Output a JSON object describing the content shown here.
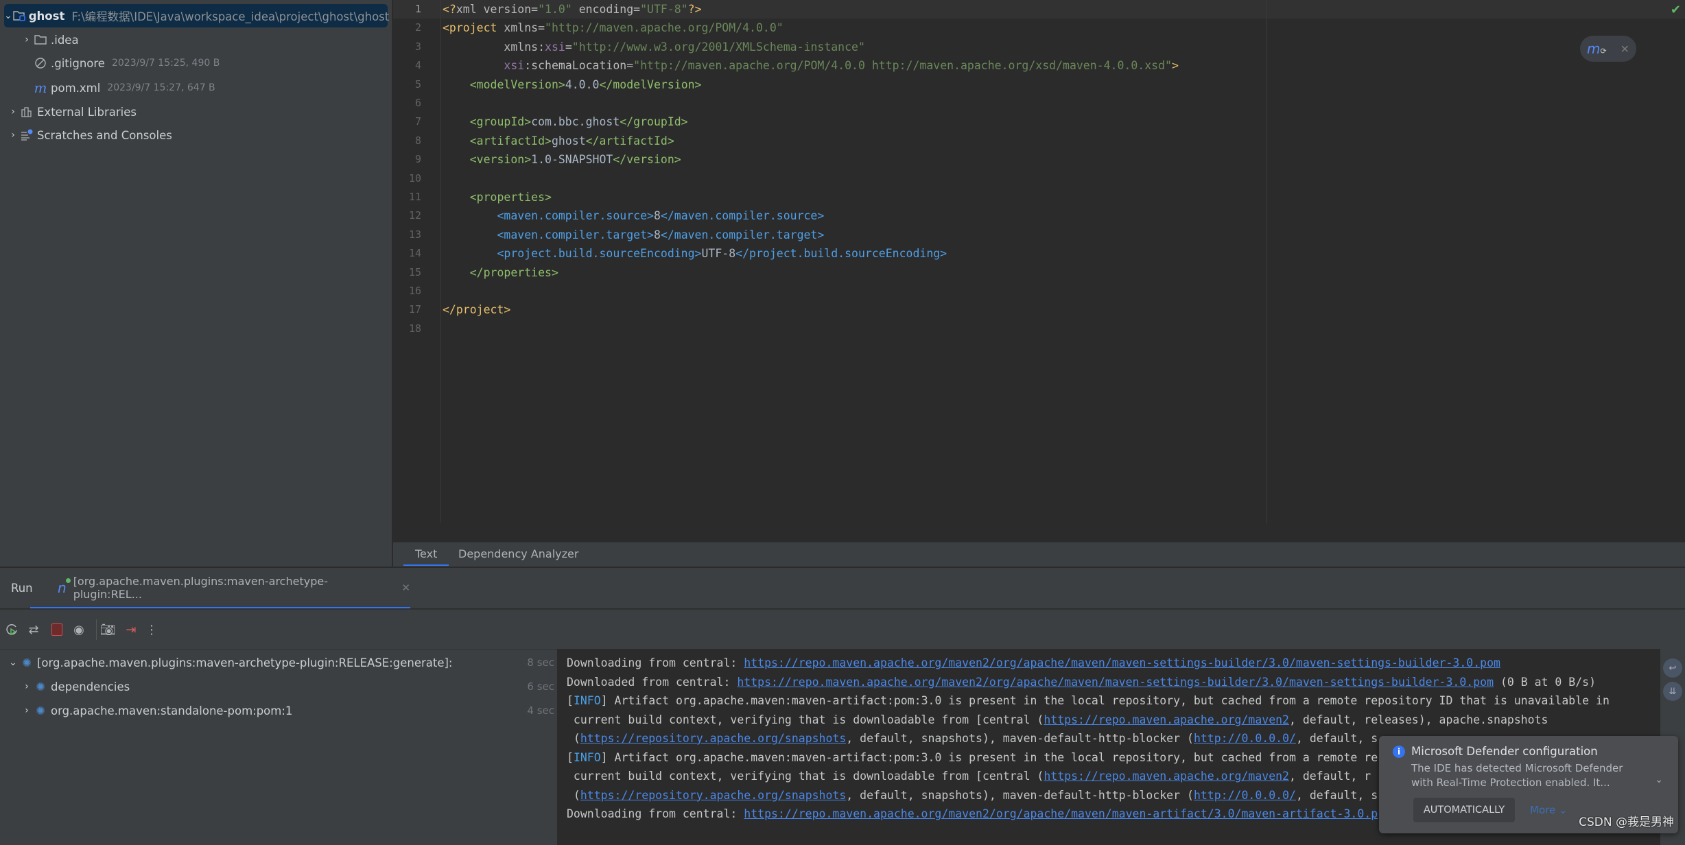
{
  "project_tree": {
    "root": {
      "name": "ghost",
      "path": "F:\\编程数据\\IDE\\Java\\workspace_idea\\project\\ghost\\ghost"
    },
    "items": [
      {
        "name": ".idea",
        "icon": "folder-icon",
        "meta": ""
      },
      {
        "name": ".gitignore",
        "icon": "ignore-icon",
        "meta": "2023/9/7 15:25, 490 B"
      },
      {
        "name": "pom.xml",
        "icon": "maven-icon",
        "meta": "2023/9/7 15:27, 647 B"
      }
    ],
    "external_libraries": "External Libraries",
    "scratches": "Scratches and Consoles"
  },
  "editor": {
    "lines": [
      [
        [
          "t-pi",
          "<?"
        ],
        [
          "t-attr",
          "xml version"
        ],
        [
          "t-attr",
          "="
        ],
        [
          "t-val",
          "\"1.0\""
        ],
        [
          "t-attr",
          " encoding"
        ],
        [
          "t-attr",
          "="
        ],
        [
          "t-val",
          "\"UTF-8\""
        ],
        [
          "t-pi",
          "?>"
        ]
      ],
      [
        [
          "t-tag",
          "<project"
        ],
        [
          "t-attr",
          " xmlns"
        ],
        [
          "t-attr",
          "="
        ],
        [
          "t-val",
          "\"http://maven.apache.org/POM/4.0.0\""
        ]
      ],
      [
        [
          "t-attr",
          "         xmlns:"
        ],
        [
          "t-ns",
          "xsi"
        ],
        [
          "t-attr",
          "="
        ],
        [
          "t-val",
          "\"http://www.w3.org/2001/XMLSchema-instance\""
        ]
      ],
      [
        [
          "t-attr",
          "         "
        ],
        [
          "t-ns",
          "xsi"
        ],
        [
          "t-attr",
          ":schemaLocation="
        ],
        [
          "t-val",
          "\"http://maven.apache.org/POM/4.0.0 http://maven.apache.org/xsd/maven-4.0.0.xsd\""
        ],
        [
          "t-tag",
          ">"
        ]
      ],
      [
        [
          "t-g",
          "    <modelVersion>"
        ],
        [
          "t-txt",
          "4.0.0"
        ],
        [
          "t-g",
          "</modelVersion>"
        ]
      ],
      [],
      [
        [
          "t-g",
          "    <groupId>"
        ],
        [
          "t-txt",
          "com.bbc.ghost"
        ],
        [
          "t-g",
          "</groupId>"
        ]
      ],
      [
        [
          "t-g",
          "    <artifactId>"
        ],
        [
          "t-txt",
          "ghost"
        ],
        [
          "t-g",
          "</artifactId>"
        ]
      ],
      [
        [
          "t-g",
          "    <version>"
        ],
        [
          "t-txt",
          "1.0-SNAPSHOT"
        ],
        [
          "t-g",
          "</version>"
        ]
      ],
      [],
      [
        [
          "t-g",
          "    <properties>"
        ]
      ],
      [
        [
          "t-b",
          "        <maven.compiler.source>"
        ],
        [
          "t-txt",
          "8"
        ],
        [
          "t-b",
          "</maven.compiler.source>"
        ]
      ],
      [
        [
          "t-b",
          "        <maven.compiler.target>"
        ],
        [
          "t-txt",
          "8"
        ],
        [
          "t-b",
          "</maven.compiler.target>"
        ]
      ],
      [
        [
          "t-b",
          "        <project.build.sourceEncoding>"
        ],
        [
          "t-txt",
          "UTF-8"
        ],
        [
          "t-b",
          "</project.build.sourceEncoding>"
        ]
      ],
      [
        [
          "t-g",
          "    </properties>"
        ]
      ],
      [],
      [
        [
          "t-tag",
          "</project>"
        ]
      ],
      []
    ],
    "tabs": [
      "Text",
      "Dependency Analyzer"
    ]
  },
  "run": {
    "title": "Run",
    "tab_label": "[org.apache.maven.plugins:maven-archetype-plugin:REL...",
    "toolbar": [
      "rerun-icon",
      "rerun-failed-icon",
      "stop-icon",
      "view-icon",
      "screenshot-icon",
      "exit-icon",
      "more-icon"
    ],
    "tree": [
      {
        "label": "[org.apache.maven.plugins:maven-archetype-plugin:RELEASE:generate]:",
        "time": "8 sec"
      },
      {
        "label": "dependencies",
        "time": "6 sec"
      },
      {
        "label": "org.apache.maven:standalone-pom:pom:1",
        "time": "4 sec"
      }
    ],
    "console": [
      [
        [
          "",
          "Downloading from central: "
        ],
        [
          "lnk",
          "https://repo.maven.apache.org/maven2/org/apache/maven/maven-settings-builder/3.0/maven-settings-builder-3.0.pom"
        ]
      ],
      [
        [
          "",
          "Downloaded from central: "
        ],
        [
          "lnk",
          "https://repo.maven.apache.org/maven2/org/apache/maven/maven-settings-builder/3.0/maven-settings-builder-3.0.pom"
        ],
        [
          "",
          " (0 B at 0 B/s)"
        ]
      ],
      [
        [
          "",
          "["
        ],
        [
          "info",
          "INFO"
        ],
        [
          "",
          "] Artifact org.apache.maven:maven-artifact:pom:3.0 is present in the local repository, but cached from a remote repository ID that is unavailable in"
        ]
      ],
      [
        [
          "",
          " current build context, verifying that is downloadable from [central ("
        ],
        [
          "lnk",
          "https://repo.maven.apache.org/maven2"
        ],
        [
          "",
          ", default, releases), apache.snapshots"
        ]
      ],
      [
        [
          "",
          " ("
        ],
        [
          "lnk",
          "https://repository.apache.org/snapshots"
        ],
        [
          "",
          ", default, snapshots), maven-default-http-blocker ("
        ],
        [
          "lnk",
          "http://0.0.0.0/"
        ],
        [
          "",
          ", default, s"
        ]
      ],
      [
        [
          "",
          "["
        ],
        [
          "info",
          "INFO"
        ],
        [
          "",
          "] Artifact org.apache.maven:maven-artifact:pom:3.0 is present in the local repository, but cached from a remote re"
        ]
      ],
      [
        [
          "",
          " current build context, verifying that is downloadable from [central ("
        ],
        [
          "lnk",
          "https://repo.maven.apache.org/maven2"
        ],
        [
          "",
          ", default, r"
        ]
      ],
      [
        [
          "",
          " ("
        ],
        [
          "lnk",
          "https://repository.apache.org/snapshots"
        ],
        [
          "",
          ", default, snapshots), maven-default-http-blocker ("
        ],
        [
          "lnk",
          "http://0.0.0.0/"
        ],
        [
          "",
          ", default, s"
        ]
      ],
      [
        [
          "",
          "Downloading from central: "
        ],
        [
          "lnk",
          "https://repo.maven.apache.org/maven2/org/apache/maven/maven-artifact/3.0/maven-artifact-3.0.p"
        ]
      ]
    ]
  },
  "notification": {
    "title": "Microsoft Defender configuration",
    "body_line1": "The IDE has detected Microsoft Defender",
    "body_line2": "with Real-Time Protection enabled. It...",
    "action": "AUTOMATICALLY",
    "more": "More"
  },
  "watermark": "CSDN @莪是男神",
  "colors": {
    "accent": "#3574f0",
    "stop": "#c94f4f",
    "ok": "#5fb865"
  }
}
